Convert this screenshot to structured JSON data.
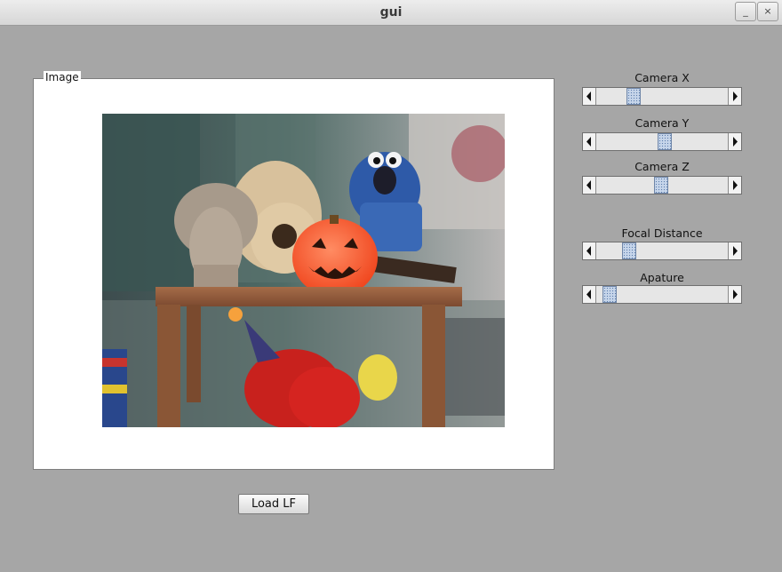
{
  "window": {
    "title": "gui",
    "minimize_glyph": "_",
    "close_glyph": "×"
  },
  "panel": {
    "label": "Image"
  },
  "actions": {
    "load_label": "Load LF"
  },
  "sliders": [
    {
      "id": "camera-x",
      "label": "Camera X",
      "value": 0.26
    },
    {
      "id": "camera-y",
      "label": "Camera Y",
      "value": 0.52
    },
    {
      "id": "camera-z",
      "label": "Camera Z",
      "value": 0.49
    },
    {
      "id": "focal-distance",
      "label": "Focal Distance",
      "value": 0.22
    },
    {
      "id": "apature",
      "label": "Apature",
      "value": 0.05
    }
  ],
  "colors": {
    "thumb": "#c6d5ea",
    "background": "#a6a6a6",
    "pumpkin": "#ff6a3a"
  }
}
